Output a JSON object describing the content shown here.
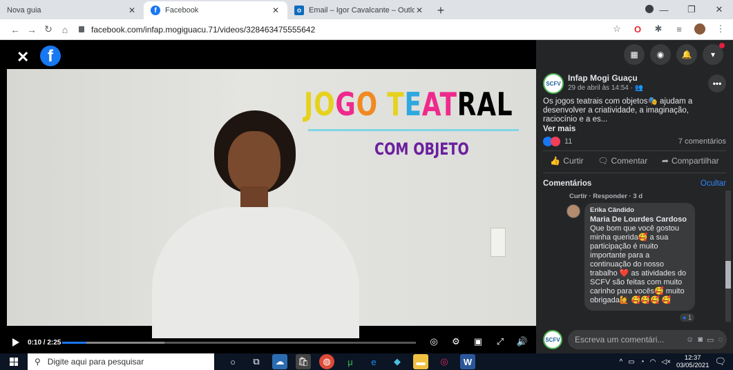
{
  "browser": {
    "tabs": [
      {
        "label": "Nova guia",
        "favicon": "none",
        "active": false
      },
      {
        "label": "Facebook",
        "favicon": "facebook-icon",
        "active": true
      },
      {
        "label": "Email – Igor Cavalcante – Outlook",
        "favicon": "outlook-icon",
        "active": false
      }
    ],
    "url": "facebook.com/infap.mogiguacu.71/videos/328463475555642",
    "new_tab_symbol": "+"
  },
  "video": {
    "title_line1_letters": [
      "J",
      "O",
      "G",
      "O",
      " ",
      "T",
      "E",
      "A",
      "T",
      "R",
      "A",
      "L"
    ],
    "title_line1": "JOGO TEATRAL",
    "title_line2": "COM OBJETO",
    "time": "0:10 / 2:25",
    "progress_fraction": 0.069,
    "buffered_fraction": 0.29
  },
  "panel": {
    "page_name": "Infap Mogi Guaçu",
    "avatar_text": "SCFV",
    "post_date": "29 de abril às 14:54 · ",
    "post_text": "Os jogos teatrais com objetos🎭 ajudam a desenvolver a criatividade, a imaginação, raciocínio e a es...",
    "see_more": "Ver mais",
    "reaction_count": "11",
    "comments_count": "7 comentários",
    "actions": {
      "like": "Curtir",
      "comment": "Comentar",
      "share": "Compartilhar"
    },
    "comments_title": "Comentários",
    "hide": "Ocultar",
    "prev_comment_actions": "Curtir · Responder · 3 d",
    "comment": {
      "author": "Erika Cândido",
      "mention": "Maria De Lourdes Cardoso",
      "body": "Que bom que você gostou minha querida🥰 a sua participação é muito importante para a continuação do nosso trabalho ❤️ as atividades do SCFV são feitas com muito carinho para vocês🥰 muito obrigada🙋 🥰🥰🥰 🥰",
      "reaction_count": "1"
    },
    "compose_placeholder": "Escreva um comentári..."
  },
  "taskbar": {
    "search_placeholder": "Digite aqui para pesquisar",
    "time": "12:37",
    "date": "03/05/2021"
  },
  "colors": {
    "facebook_blue": "#1877f2",
    "panel_bg": "#242526",
    "bubble_bg": "#3a3b3c",
    "link_blue": "#2d88ff"
  }
}
